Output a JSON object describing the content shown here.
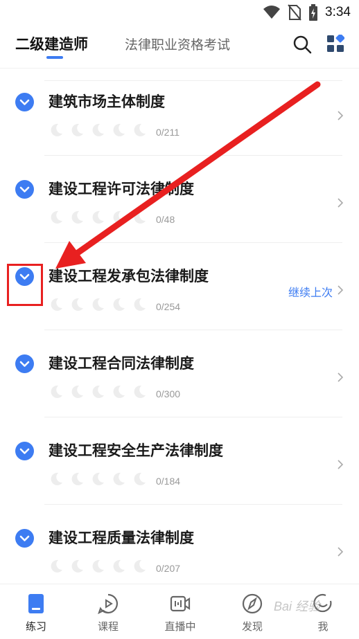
{
  "status_bar": {
    "time": "3:34"
  },
  "header": {
    "active_tab": "二级建造师",
    "inactive_tab": "法律职业资格考试"
  },
  "chapters": [
    {
      "title": "建筑市场主体制度",
      "progress": "0/211",
      "stars_filled": 0,
      "stars_total": 5,
      "continue_label": ""
    },
    {
      "title": "建设工程许可法律制度",
      "progress": "0/48",
      "stars_filled": 0,
      "stars_total": 5,
      "continue_label": ""
    },
    {
      "title": "建设工程发承包法律制度",
      "progress": "0/254",
      "stars_filled": 0,
      "stars_total": 5,
      "continue_label": "继续上次"
    },
    {
      "title": "建设工程合同法律制度",
      "progress": "0/300",
      "stars_filled": 0,
      "stars_total": 5,
      "continue_label": ""
    },
    {
      "title": "建设工程安全生产法律制度",
      "progress": "0/184",
      "stars_filled": 0,
      "stars_total": 5,
      "continue_label": ""
    },
    {
      "title": "建设工程质量法律制度",
      "progress": "0/207",
      "stars_filled": 0,
      "stars_total": 5,
      "continue_label": ""
    }
  ],
  "bottom_nav": [
    {
      "label": "练习",
      "icon": "book-icon",
      "active": true
    },
    {
      "label": "课程",
      "icon": "play-bubble-icon",
      "active": false
    },
    {
      "label": "直播中",
      "icon": "live-camera-icon",
      "active": false
    },
    {
      "label": "发现",
      "icon": "compass-icon",
      "active": false
    },
    {
      "label": "我",
      "icon": "smile-icon",
      "active": false
    }
  ],
  "colors": {
    "accent": "#3d7cf2",
    "annotation": "#e82020"
  },
  "watermark": "Bai 经验"
}
